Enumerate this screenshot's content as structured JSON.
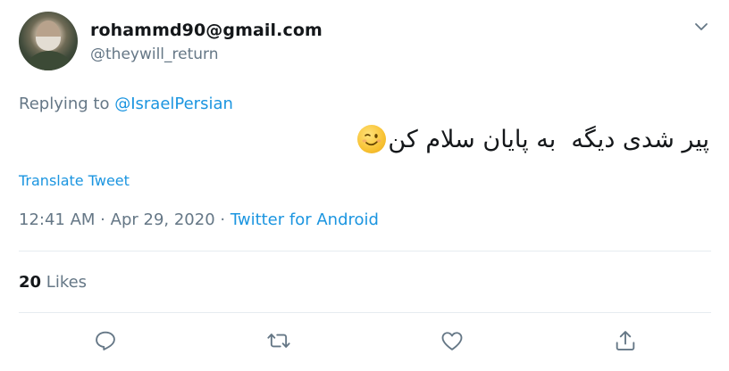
{
  "user": {
    "display_name": "rohammd90@gmail.com",
    "handle": "@theywill_return"
  },
  "reply": {
    "prefix": "Replying to ",
    "to_handle": "@IsraelPersian"
  },
  "tweet": {
    "text": "پیر شدی دیگه  به پایان سلام کن",
    "emoji": "winking-face"
  },
  "translate_label": "Translate Tweet",
  "meta": {
    "time": "12:41 AM",
    "sep1": " · ",
    "date": "Apr 29, 2020",
    "sep2": " · ",
    "source": "Twitter for Android"
  },
  "stats": {
    "likes_count": "20",
    "likes_label": " Likes"
  },
  "colors": {
    "accent": "#1b95e0",
    "secondary_text": "#657786",
    "divider": "#e6ecf0"
  },
  "icons": [
    "chevron-down-icon",
    "reply-icon",
    "retweet-icon",
    "like-icon",
    "share-icon"
  ]
}
